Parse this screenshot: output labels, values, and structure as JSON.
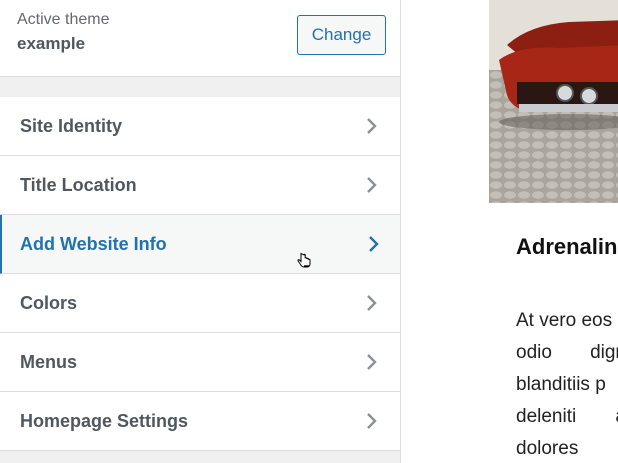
{
  "theme": {
    "label": "Active theme",
    "name": "example",
    "change_label": "Change"
  },
  "menu": {
    "items": [
      {
        "label": "Site Identity"
      },
      {
        "label": "Title Location"
      },
      {
        "label": "Add Website Info",
        "active": true
      },
      {
        "label": "Colors"
      },
      {
        "label": "Menus"
      },
      {
        "label": "Homepage Settings"
      }
    ]
  },
  "preview": {
    "title": "Adrenalin",
    "body": {
      "line1": "At vero eos",
      "line2a": "odio",
      "line2b": "dign",
      "line3": "blanditiis p",
      "line4a": "deleniti",
      "line4b": "a",
      "line5": "dolores"
    }
  },
  "icons": {
    "chevron": "chevron-right-icon",
    "cursor": "hand-pointer-icon"
  },
  "colors": {
    "accent": "#2271b1",
    "text": "#50575e"
  }
}
